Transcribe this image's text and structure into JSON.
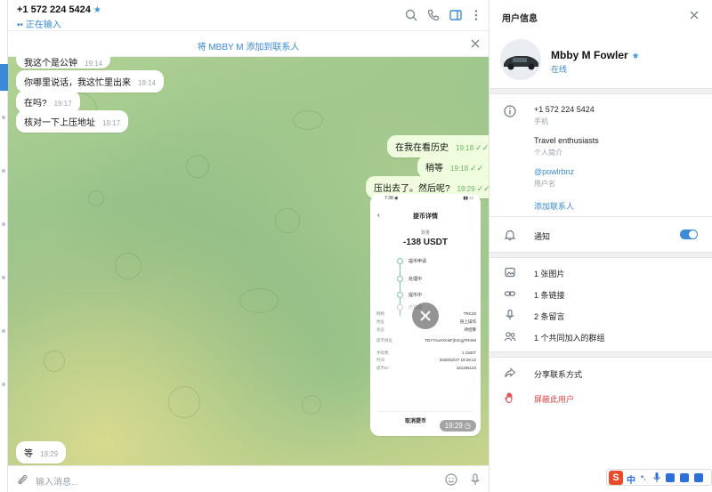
{
  "chat": {
    "header": {
      "phone": "+1 572 224 5424",
      "status": "•• 正在输入"
    },
    "add_contact_bar": "将 MBBY M 添加到联系人",
    "messages": [
      {
        "text": "我这个是公钟",
        "time": "19:14",
        "dir": "in"
      },
      {
        "text": "你哪里说话，我这忙里出来",
        "time": "19:14",
        "dir": "in"
      },
      {
        "text": "在吗?",
        "time": "19:17",
        "dir": "in"
      },
      {
        "text": "核对一下上压地址",
        "time": "19:17",
        "dir": "in"
      },
      {
        "text": "在我在看历史",
        "time": "19:18",
        "dir": "out"
      },
      {
        "text": "稍等",
        "time": "19:18",
        "dir": "out"
      },
      {
        "text": "压出去了。然后呢?",
        "time": "19:29",
        "dir": "out"
      },
      {
        "text": "等",
        "time": "19:29",
        "dir": "in"
      }
    ],
    "media": {
      "status_bar": "7:38 ◉",
      "title": "提币详情",
      "amount_label": "数量",
      "amount": "-138 USDT",
      "steps": [
        "提币申请",
        "处理中",
        "提币中",
        "已完成"
      ],
      "rows": [
        {
          "k": "网络",
          "v": "TRC20"
        },
        {
          "k": "地址",
          "v": "链上操作"
        },
        {
          "k": "状态",
          "v": "待结算"
        },
        {
          "k": "提币地址",
          "v": "TDYYsuXXmkFjh2CgjTRmM"
        },
        {
          "k": "手续费",
          "v": "1 USDT"
        },
        {
          "k": "时间",
          "v": "2026/02/27 19:28:12"
        },
        {
          "k": "提币ID",
          "v": "161195123"
        }
      ],
      "cancel_button": "取消提币",
      "time": "19:29"
    },
    "composer_placeholder": "输入消息..."
  },
  "info": {
    "title": "用户信息",
    "name": "Mbby M Fowler",
    "status": "在线",
    "phone": "+1 572 224 5424",
    "phone_label": "手机",
    "bio": "Travel enthusiasts",
    "bio_label": "个人简介",
    "username": "@powlrbnz",
    "username_label": "用户名",
    "add_contact": "添加联系人",
    "notifications": "通知",
    "notifications_on": true,
    "shared": [
      {
        "icon": "photo-icon",
        "label": "1 张图片"
      },
      {
        "icon": "link-icon",
        "label": "1 条链接"
      },
      {
        "icon": "microphone-icon",
        "label": "2 条留言"
      },
      {
        "icon": "group-icon",
        "label": "1 个共同加入的群组"
      }
    ],
    "share_contact": "分享联系方式",
    "block_user": "屏蔽此用户"
  },
  "ime": {
    "logo": "S",
    "mode": "中"
  },
  "colors": {
    "accent": "#3a8ad8",
    "out_bubble": "#effdde",
    "danger": "#e04848"
  }
}
